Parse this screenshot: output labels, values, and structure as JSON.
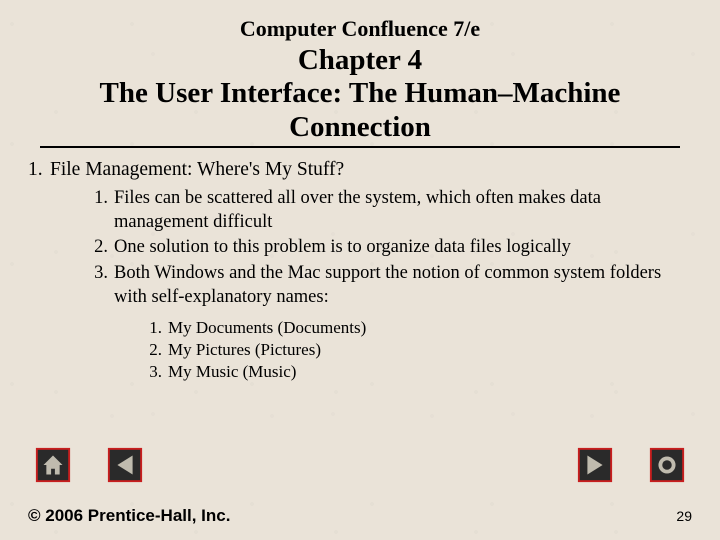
{
  "book_title": "Computer Confluence 7/e",
  "chapter": {
    "number_line": "Chapter 4",
    "title_line1": "The User Interface: The Human–Machine",
    "title_line2": "Connection"
  },
  "outline": {
    "lvl1": {
      "num": "1.",
      "text": "File Management: Where's My Stuff?"
    },
    "lvl2": [
      {
        "num": "1.",
        "text": "Files can be scattered all over the system, which often makes data management difficult"
      },
      {
        "num": "2.",
        "text": "One solution to this problem is to organize data files logically"
      },
      {
        "num": "3.",
        "text": "Both Windows and the Mac support the notion of common system folders with self-explanatory names:"
      }
    ],
    "lvl3": [
      {
        "num": "1.",
        "text": "My Documents (Documents)"
      },
      {
        "num": "2.",
        "text": "My Pictures (Pictures)"
      },
      {
        "num": "3.",
        "text": " My Music (Music)"
      }
    ]
  },
  "nav": {
    "home": "home-icon",
    "prev": "prev-icon",
    "next": "next-icon",
    "end": "end-icon"
  },
  "footer": {
    "copyright": "© 2006 Prentice-Hall, Inc.",
    "page_number": "29"
  },
  "colors": {
    "accent_red": "#c81e1e",
    "button_fill": "#2a2a2a",
    "bg": "#eae3d8"
  }
}
